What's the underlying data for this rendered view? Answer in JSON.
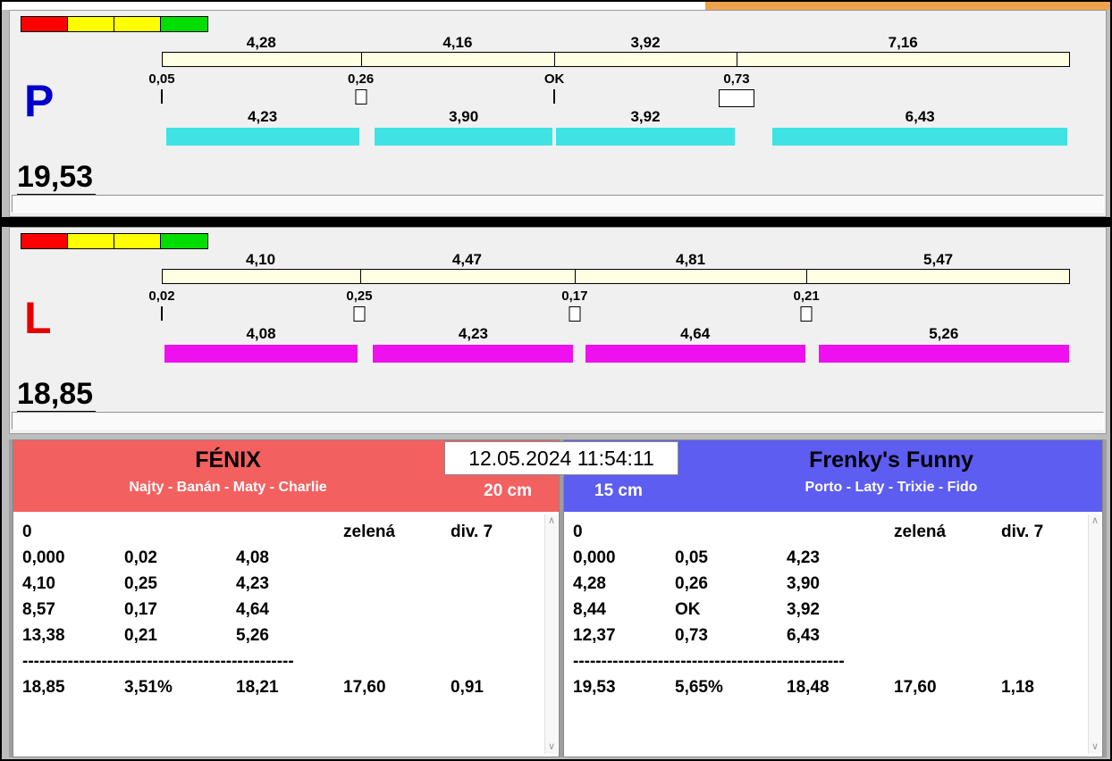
{
  "window": {
    "strip_left_color": "#ffffff",
    "strip_right_color": "#eea24e"
  },
  "legend_colors": [
    "#ff0000",
    "#ffff00",
    "#ffff00",
    "#00dd00"
  ],
  "lanes": [
    {
      "letter": "P",
      "letter_color": "#0000cc",
      "total_label": "19,53",
      "total_value": 19.53,
      "top_bar_color": "#ffffe3",
      "run_bar_color": "#3fe3e3",
      "top_segments": [
        {
          "label": "4,28",
          "value": 4.28
        },
        {
          "label": "4,16",
          "value": 4.16
        },
        {
          "label": "3,92",
          "value": 3.92
        },
        {
          "label": "7,16",
          "value": 7.16
        }
      ],
      "change_marks": [
        {
          "label": "0,05",
          "marker": "tick"
        },
        {
          "label": "0,26",
          "marker": "box"
        },
        {
          "label": "OK",
          "marker": "tick"
        },
        {
          "label": "0,73",
          "marker": "wide-box"
        }
      ],
      "run_segments": [
        {
          "label": "4,23",
          "value": 4.23,
          "gap_before": 0.05
        },
        {
          "label": "3,90",
          "value": 3.9,
          "gap_before": 0.26
        },
        {
          "label": "3,92",
          "value": 3.92,
          "gap_before": 0.0
        },
        {
          "label": "6,43",
          "value": 6.43,
          "gap_before": 0.73
        }
      ]
    },
    {
      "letter": "L",
      "letter_color": "#e60000",
      "total_label": "18,85",
      "total_value": 18.85,
      "top_bar_color": "#ffffe3",
      "run_bar_color": "#ef10ef",
      "top_segments": [
        {
          "label": "4,10",
          "value": 4.1
        },
        {
          "label": "4,47",
          "value": 4.47
        },
        {
          "label": "4,81",
          "value": 4.81
        },
        {
          "label": "5,47",
          "value": 5.47
        }
      ],
      "change_marks": [
        {
          "label": "0,02",
          "marker": "tick"
        },
        {
          "label": "0,25",
          "marker": "box"
        },
        {
          "label": "0,17",
          "marker": "box"
        },
        {
          "label": "0,21",
          "marker": "box"
        }
      ],
      "run_segments": [
        {
          "label": "4,08",
          "value": 4.08,
          "gap_before": 0.02
        },
        {
          "label": "4,23",
          "value": 4.23,
          "gap_before": 0.25
        },
        {
          "label": "4,64",
          "value": 4.64,
          "gap_before": 0.17
        },
        {
          "label": "5,26",
          "value": 5.26,
          "gap_before": 0.21
        }
      ]
    }
  ],
  "timestamp": "12.05.2024 11:54:11",
  "scrollbar": {
    "up_glyph": "∧",
    "down_glyph": "∨"
  },
  "teams": [
    {
      "name": "FÉNIX",
      "members": "Najty - Banán - Maty - Charlie",
      "height": "20 cm",
      "header_color": "#f36060",
      "rows": [
        [
          "0",
          "",
          "",
          "zelená",
          "div. 7"
        ],
        [
          "0,000",
          "0,02",
          "4,08",
          "",
          ""
        ],
        [
          "4,10",
          "0,25",
          "4,23",
          "",
          ""
        ],
        [
          "8,57",
          "0,17",
          "4,64",
          "",
          ""
        ],
        [
          "13,38",
          "0,21",
          "5,26",
          "",
          ""
        ]
      ],
      "divider": "------------------------------------------------",
      "totals": [
        "18,85",
        "3,51%",
        "18,21",
        "17,60",
        "0,91"
      ]
    },
    {
      "name": "Frenky's Funny",
      "members": "Porto - Laty - Trixie - Fido",
      "height": "15 cm",
      "header_color": "#5d5df2",
      "rows": [
        [
          "0",
          "",
          "",
          "zelená",
          "div. 7"
        ],
        [
          "0,000",
          "0,05",
          "4,23",
          "",
          ""
        ],
        [
          "4,28",
          "0,26",
          "3,90",
          "",
          ""
        ],
        [
          "8,44",
          "OK",
          "3,92",
          "",
          ""
        ],
        [
          "12,37",
          "0,73",
          "6,43",
          "",
          ""
        ]
      ],
      "divider": "------------------------------------------------",
      "totals": [
        "19,53",
        "5,65%",
        "18,48",
        "17,60",
        "1,18"
      ]
    }
  ]
}
